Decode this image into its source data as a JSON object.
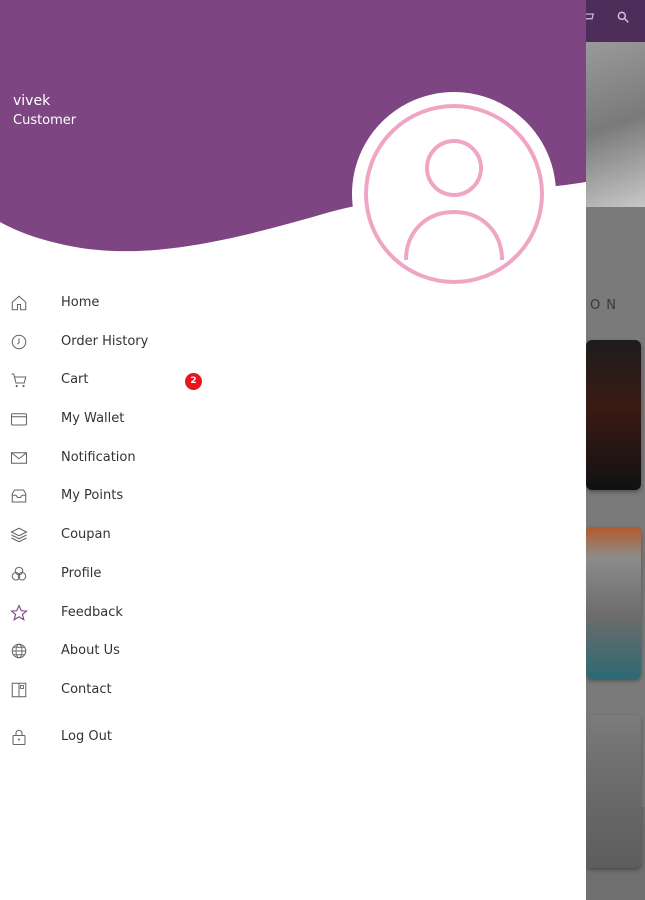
{
  "user": {
    "name": "vivek",
    "role": "Customer"
  },
  "colors": {
    "header_purple": "#7d4581",
    "avatar_pink": "#f0a5c4",
    "badge_red": "#e8161c"
  },
  "menu": {
    "items": [
      {
        "label": "Home",
        "icon": "home-icon"
      },
      {
        "label": "Order History",
        "icon": "clock-icon"
      },
      {
        "label": "Cart",
        "icon": "cart-icon",
        "badge": "2"
      },
      {
        "label": "My Wallet",
        "icon": "wallet-icon"
      },
      {
        "label": "Notification",
        "icon": "mail-icon"
      },
      {
        "label": "My Points",
        "icon": "inbox-icon"
      },
      {
        "label": "Coupan",
        "icon": "layers-icon"
      },
      {
        "label": "Profile",
        "icon": "circles-icon"
      },
      {
        "label": "Feedback",
        "icon": "star-icon"
      },
      {
        "label": "About Us",
        "icon": "globe-icon"
      },
      {
        "label": "Contact",
        "icon": "contact-book-icon"
      },
      {
        "label": "Log Out",
        "icon": "lock-icon"
      }
    ]
  },
  "background": {
    "section_text": "ON"
  }
}
